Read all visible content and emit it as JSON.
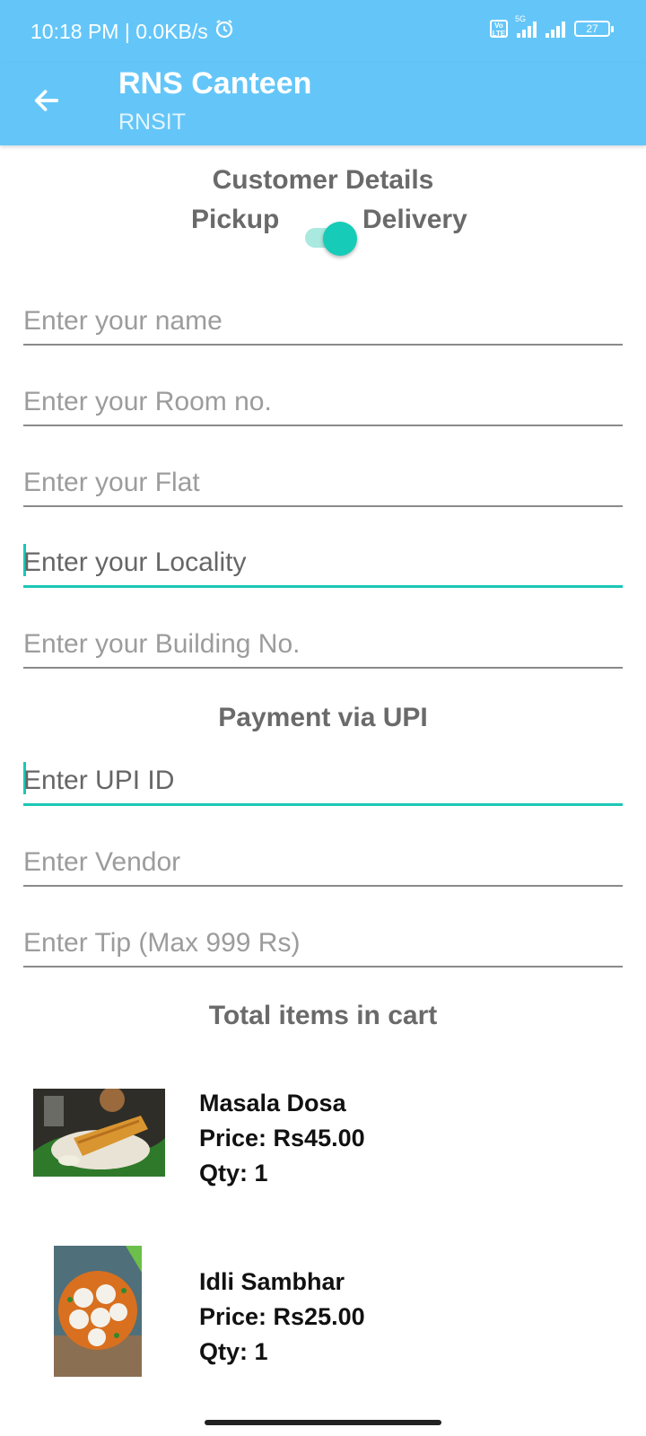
{
  "status_bar": {
    "time_speed": "10:18 PM | 0.0KB/s",
    "network": "5G",
    "volte": "Vo LTE",
    "battery": "27"
  },
  "app_bar": {
    "title": "RNS Canteen",
    "subtitle": "RNSIT"
  },
  "customer_details": {
    "heading": "Customer Details",
    "toggle": {
      "left_label": "Pickup",
      "right_label": "Delivery",
      "state": "Delivery"
    }
  },
  "fields": {
    "name": "Enter your name",
    "room": "Enter your Room no.",
    "flat": "Enter your Flat",
    "locality": "Enter your Locality",
    "building": "Enter your Building No."
  },
  "payment": {
    "heading": "Payment via UPI",
    "upi": "Enter UPI ID",
    "vendor": "Enter Vendor",
    "tip": "Enter Tip (Max 999 Rs)"
  },
  "cart": {
    "heading": "Total items in cart",
    "items": [
      {
        "name": "Masala Dosa",
        "price": "Price: Rs45.00",
        "qty": "Qty: 1"
      },
      {
        "name": "Idli Sambhar",
        "price": "Price: Rs25.00",
        "qty": "Qty: 1"
      }
    ]
  },
  "colors": {
    "app_bar": "#64c6f8",
    "accent": "#1cc7b6"
  }
}
